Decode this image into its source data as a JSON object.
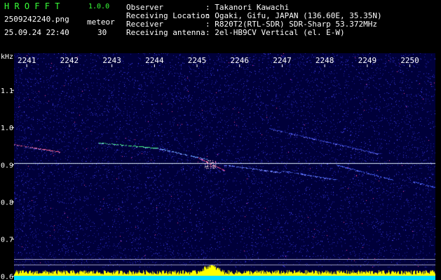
{
  "header": {
    "app_name": "H R O F F T",
    "version": "1.0.0",
    "filename": "2509242240.png",
    "mode_label": "meteor",
    "datetime": "25.09.24 22:40",
    "count": "30",
    "observer_label": "Observer",
    "observer_value": ": Takanori Kawachi",
    "location_label": "Receiving Location",
    "location_value": ": Ogaki, Gifu, JAPAN (136.60E, 35.35N)",
    "receiver_label": "Receiver",
    "receiver_value": ": R820T2(RTL-SDR) SDR-Sharp 53.372MHz",
    "antenna_label": "Receiving antenna",
    "antenna_value": ": 2el-HB9CV Vertical (el. E-W)"
  },
  "chart_data": {
    "type": "heatmap",
    "y_unit_label": "kHz",
    "x_ticks": [
      "2241",
      "2242",
      "2243",
      "2244",
      "2245",
      "2246",
      "2247",
      "2248",
      "2249",
      "2250"
    ],
    "y_ticks": [
      "1.1",
      "1.0",
      "0.9",
      "0.8",
      "0.7",
      "0.6"
    ],
    "y_tick_values": [
      1.1,
      1.0,
      0.9,
      0.8,
      0.7,
      0.6
    ],
    "x_range": [
      2240.7,
      2250.6
    ],
    "y_range": [
      0.59,
      1.2
    ],
    "carrier_khz": 0.905,
    "colors": {
      "background": "#00003a",
      "noise": "#3030ff",
      "carrier": "#d0e8ff",
      "signal_hot": "#ff4080",
      "signal_warm": "#40ff80",
      "level_bar": "#ffff00",
      "level_base": "#00e0ff",
      "ref_line": "#9090b0"
    }
  }
}
